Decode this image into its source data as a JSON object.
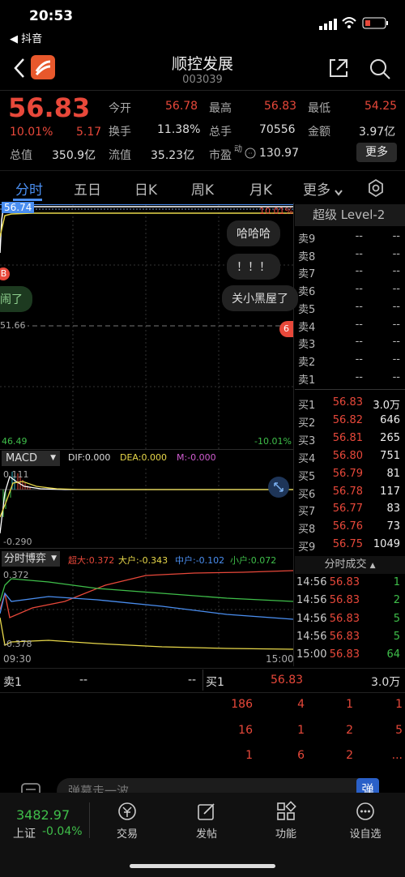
{
  "status": {
    "time": "20:53",
    "back_app": "◀ 抖音"
  },
  "header": {
    "title": "顺控发展",
    "code": "003039"
  },
  "quote": {
    "price": "56.83",
    "pct": "10.01%",
    "change": "5.17",
    "open_l": "今开",
    "open": "56.78",
    "high_l": "最高",
    "high": "56.83",
    "low_l": "最低",
    "low": "54.25",
    "turn_l": "换手",
    "turn": "11.38%",
    "vol_l": "总手",
    "vol": "70556",
    "amt_l": "金额",
    "amt": "3.97亿",
    "cap_l": "总值",
    "cap": "350.9亿",
    "float_l": "流值",
    "float": "35.23亿",
    "pe_l": "市盈",
    "pe_sup": "动",
    "pe": "130.97",
    "more": "更多"
  },
  "tabs": [
    "分时",
    "五日",
    "日K",
    "周K",
    "月K",
    "更多"
  ],
  "chart": {
    "top_price": "56.74",
    "top_pct": "10.01%",
    "mid_price": "51.66",
    "bot_price": "46.49",
    "bot_pct": "-10.01%",
    "marker_b": "B",
    "marker_6": "6"
  },
  "bubbles": [
    "哈哈哈",
    "！！！",
    "关小黑屋了",
    "闹了"
  ],
  "macd": {
    "label": "MACD",
    "dif": "DIF:0.000",
    "dea": "DEA:0.000",
    "m": "M:-0.000",
    "top": "0.111",
    "bot": "-0.290"
  },
  "bo": {
    "label": "分时博弈",
    "s1": "超大:0.372",
    "s2": "大户:-0.343",
    "s3": "中户:-0.102",
    "s4": "小户:0.072",
    "top": "0.372",
    "bot": "-0.378",
    "t0": "09:30",
    "t1": "15:00"
  },
  "level2": {
    "title": "超级 Level-2",
    "sell": [
      {
        "l": "卖9",
        "p": "--",
        "v": "--"
      },
      {
        "l": "卖8",
        "p": "--",
        "v": "--"
      },
      {
        "l": "卖7",
        "p": "--",
        "v": "--"
      },
      {
        "l": "卖6",
        "p": "--",
        "v": "--"
      },
      {
        "l": "卖5",
        "p": "--",
        "v": "--"
      },
      {
        "l": "卖4",
        "p": "--",
        "v": "--"
      },
      {
        "l": "卖3",
        "p": "--",
        "v": "--"
      },
      {
        "l": "卖2",
        "p": "--",
        "v": "--"
      },
      {
        "l": "卖1",
        "p": "--",
        "v": "--"
      }
    ],
    "buy": [
      {
        "l": "买1",
        "p": "56.83",
        "v": "3.0万"
      },
      {
        "l": "买2",
        "p": "56.82",
        "v": "646"
      },
      {
        "l": "买3",
        "p": "56.81",
        "v": "265"
      },
      {
        "l": "买4",
        "p": "56.80",
        "v": "751"
      },
      {
        "l": "买5",
        "p": "56.79",
        "v": "81"
      },
      {
        "l": "买6",
        "p": "56.78",
        "v": "117"
      },
      {
        "l": "买7",
        "p": "56.77",
        "v": "83"
      },
      {
        "l": "买8",
        "p": "56.76",
        "v": "73"
      },
      {
        "l": "买9",
        "p": "56.75",
        "v": "1049"
      }
    ]
  },
  "trades": {
    "title": "分时成交",
    "rows": [
      {
        "t": "14:56",
        "p": "56.83",
        "v": "1"
      },
      {
        "t": "14:56",
        "p": "56.83",
        "v": "2"
      },
      {
        "t": "14:56",
        "p": "56.83",
        "v": "5"
      },
      {
        "t": "14:56",
        "p": "56.83",
        "v": "5"
      },
      {
        "t": "15:00",
        "p": "56.83",
        "v": "64"
      }
    ]
  },
  "queue": {
    "sell_l": "卖1",
    "sell_p": "--",
    "sell_v": "--",
    "buy_l": "买1",
    "buy_p": "56.83",
    "buy_v": "3.0万",
    "rows": [
      [
        "186",
        "4",
        "1",
        "1"
      ],
      [
        "16",
        "1",
        "2",
        "5"
      ],
      [
        "1",
        "6",
        "2",
        "..."
      ]
    ]
  },
  "danmu": {
    "placeholder": "弹幕走一波...",
    "btn": "弹"
  },
  "bottom": {
    "index": "3482.97",
    "index_name": "上证",
    "index_pct": "-0.04%",
    "items": [
      "交易",
      "发帖",
      "功能",
      "设自选"
    ]
  }
}
